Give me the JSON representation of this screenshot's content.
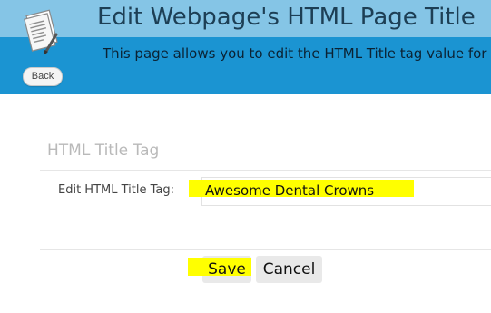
{
  "header": {
    "title": "Edit Webpage's HTML Page Title",
    "subtitle": "This page allows you to edit the HTML Title tag value for",
    "icon": "document-edit-icon",
    "back_label": "Back",
    "colors": {
      "top": "#85c5e6",
      "bottom": "#1b94d2"
    }
  },
  "form": {
    "section_title": "HTML Title Tag",
    "field_label": "Edit HTML Title Tag:",
    "field_value": "Awesome Dental Crowns",
    "highlight_color": "#ffff00"
  },
  "actions": {
    "save_label": "Save",
    "cancel_label": "Cancel"
  }
}
